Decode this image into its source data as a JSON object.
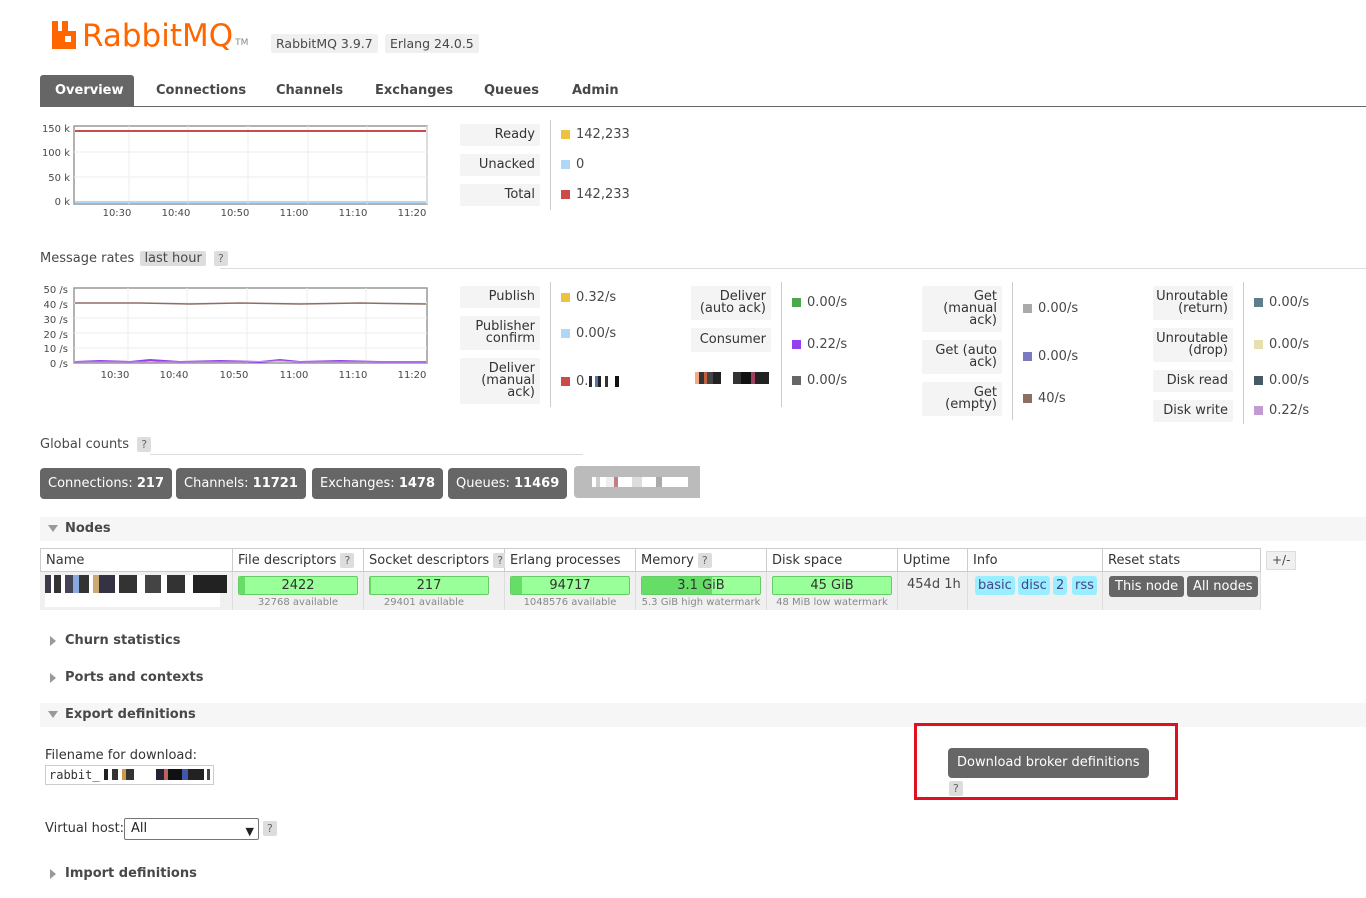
{
  "header": {
    "logo_text": "RabbitMQ",
    "logo_tm": "TM",
    "version": "RabbitMQ 3.9.7",
    "erlang": "Erlang 24.0.5"
  },
  "tabs": [
    {
      "label": "Overview",
      "active": true
    },
    {
      "label": "Connections"
    },
    {
      "label": "Channels"
    },
    {
      "label": "Exchanges"
    },
    {
      "label": "Queues"
    },
    {
      "label": "Admin"
    }
  ],
  "queued_chart": {
    "y_ticks": [
      "150 k",
      "100 k",
      "50 k",
      "0 k"
    ],
    "x_ticks": [
      "10:30",
      "10:40",
      "10:50",
      "11:00",
      "11:10",
      "11:20"
    ],
    "legend": [
      {
        "label": "Ready",
        "value": "142,233",
        "color": "#edc240"
      },
      {
        "label": "Unacked",
        "value": "0",
        "color": "#afd8f8"
      },
      {
        "label": "Total",
        "value": "142,233",
        "color": "#cb4b4b"
      }
    ]
  },
  "message_rates": {
    "title": "Message rates",
    "range": "last hour",
    "help": "?",
    "y_ticks": [
      "50 /s",
      "40 /s",
      "30 /s",
      "20 /s",
      "10 /s",
      "0 /s"
    ],
    "x_ticks": [
      "10:30",
      "10:40",
      "10:50",
      "11:00",
      "11:10",
      "11:20"
    ],
    "col1": [
      {
        "label": "Publish",
        "value": "0.32/s",
        "color": "#edc240"
      },
      {
        "label": "Publisher confirm",
        "value": "0.00/s",
        "color": "#afd8f8"
      },
      {
        "label": "Deliver (manual ack)",
        "value": "0.",
        "color": "#cb4b4b"
      }
    ],
    "col2": [
      {
        "label": "Deliver (auto ack)",
        "value": "0.00/s",
        "color": "#4da74d"
      },
      {
        "label": "Consumer",
        "value": "0.22/s",
        "color": "#9440ed"
      },
      {
        "label": "",
        "value": "0.00/s",
        "color": "#666666"
      }
    ],
    "col3": [
      {
        "label": "Get (manual ack)",
        "value": "0.00/s",
        "color": "#aaaaaa"
      },
      {
        "label": "Get (auto ack)",
        "value": "0.00/s",
        "color": "#7c79c3"
      },
      {
        "label": "Get (empty)",
        "value": "40/s",
        "color": "#8d6e63"
      }
    ],
    "col4": [
      {
        "label": "Unroutable (return)",
        "value": "0.00/s",
        "color": "#607d8b"
      },
      {
        "label": "Unroutable (drop)",
        "value": "0.00/s",
        "color": "#e6e0b0"
      },
      {
        "label": "Disk read",
        "value": "0.00/s",
        "color": "#455a64"
      },
      {
        "label": "Disk write",
        "value": "0.22/s",
        "color": "#c39bd3"
      }
    ]
  },
  "global_counts": {
    "title": "Global counts",
    "help": "?",
    "items": [
      {
        "label": "Connections:",
        "value": "217"
      },
      {
        "label": "Channels:",
        "value": "11721"
      },
      {
        "label": "Exchanges:",
        "value": "1478"
      },
      {
        "label": "Queues:",
        "value": "11469"
      }
    ]
  },
  "nodes": {
    "title": "Nodes",
    "plus_minus": "+/-",
    "headers": [
      "Name",
      "File descriptors",
      "Socket descriptors",
      "Erlang processes",
      "Memory",
      "Disk space",
      "Uptime",
      "Info",
      "Reset stats"
    ],
    "help": "?",
    "row": {
      "file_descriptors": "2422",
      "file_descriptors_sub": "32768 available",
      "socket_descriptors": "217",
      "socket_descriptors_sub": "29401 available",
      "erlang_processes": "94717",
      "erlang_processes_sub": "1048576 available",
      "memory": "3.1 GiB",
      "memory_sub": "5.3 GiB high watermark",
      "disk_space": "45 GiB",
      "disk_space_sub": "48 MiB low watermark",
      "uptime": "454d 1h",
      "info": [
        "basic",
        "disc",
        "2",
        "rss"
      ],
      "reset_this": "This node",
      "reset_all": "All nodes"
    }
  },
  "sections": {
    "churn": "Churn statistics",
    "ports": "Ports and contexts",
    "export": "Export definitions",
    "import": "Import definitions"
  },
  "export": {
    "filename_label": "Filename for download:",
    "filename_value": "rabbit_",
    "download_button": "Download broker definitions",
    "help": "?",
    "vhost_label": "Virtual host:",
    "vhost_value": "All"
  }
}
